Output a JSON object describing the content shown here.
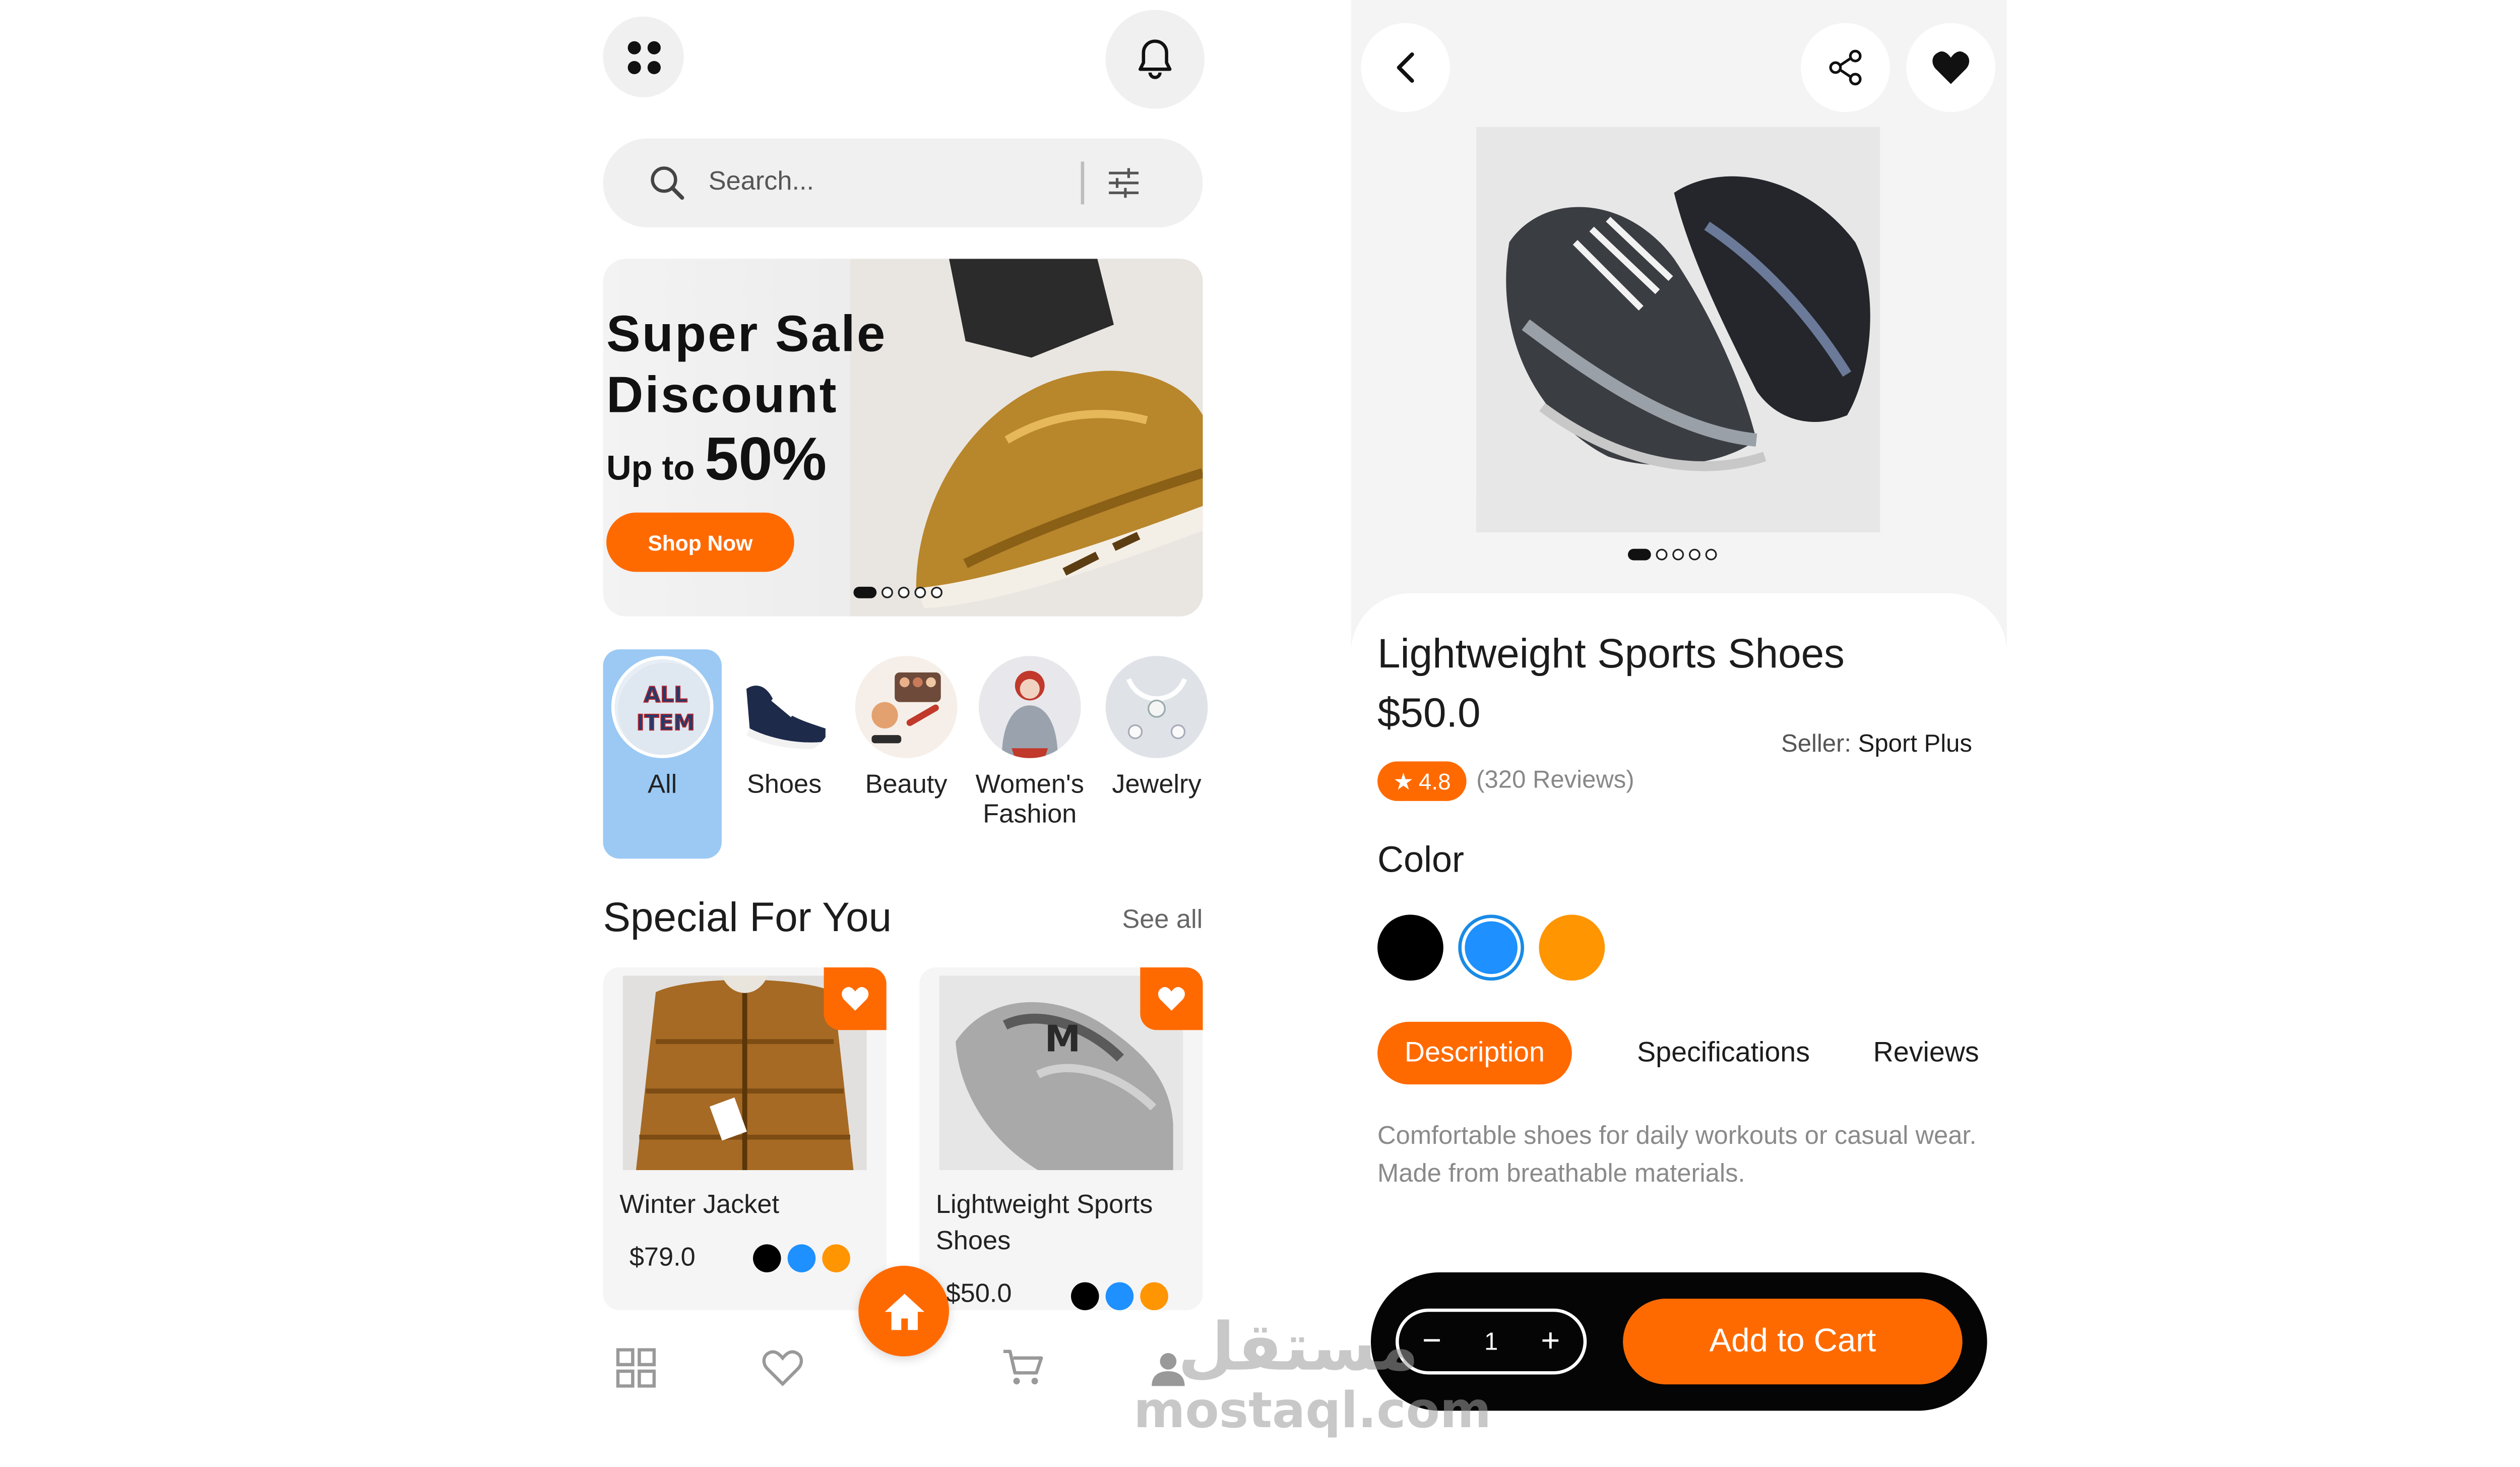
{
  "home": {
    "search": {
      "placeholder": "Search..."
    },
    "banner": {
      "line1": "Super Sale",
      "line2": "Discount",
      "upto": "Up to",
      "percent": "50%",
      "cta": "Shop Now",
      "pages": 5,
      "active_page": 1
    },
    "categories": [
      {
        "label": "All",
        "image_text": "ALL ITEM",
        "selected": true
      },
      {
        "label": "Shoes",
        "selected": false
      },
      {
        "label": "Beauty",
        "selected": false
      },
      {
        "label": "Women's Fashion",
        "selected": false
      },
      {
        "label": "Jewelry",
        "selected": false
      }
    ],
    "section": {
      "title": "Special For You",
      "see_all": "See all"
    },
    "products": [
      {
        "name": "Winter Jacket",
        "price": "$79.0",
        "colors": [
          "#000000",
          "#1e90ff",
          "#ff9500"
        ]
      },
      {
        "name": "Lightweight Sports Shoes",
        "price": "$50.0",
        "colors": [
          "#000000",
          "#1e90ff",
          "#ff9500"
        ]
      }
    ],
    "nav": [
      "grid-icon",
      "heart-icon",
      "home-icon",
      "cart-icon",
      "profile-icon"
    ]
  },
  "detail": {
    "title": "Lightweight Sports Shoes",
    "price": "$50.0",
    "seller_label": "Seller:",
    "seller_name": "Sport Plus",
    "rating": "4.8",
    "reviews": "(320 Reviews)",
    "color_label": "Color",
    "colors": [
      {
        "hex": "#000000",
        "selected": false
      },
      {
        "hex": "#1e90ff",
        "selected": true
      },
      {
        "hex": "#ff9500",
        "selected": false
      }
    ],
    "tabs": [
      {
        "label": "Description",
        "active": true
      },
      {
        "label": "Specifications",
        "active": false
      },
      {
        "label": "Reviews",
        "active": false
      }
    ],
    "description": "Comfortable shoes for daily workouts or casual wear. Made from breathable materials.",
    "quantity": "1",
    "qty_minus": "−",
    "qty_plus": "+",
    "add_to_cart": "Add to Cart",
    "gallery_pages": 5,
    "gallery_active": 1
  },
  "watermark": {
    "arabic": "مستقل",
    "latin": "mostaql.com"
  },
  "theme": {
    "accent": "#ff6a00",
    "selected_category": "#9bc9f4",
    "background_gray": "#f0f0f0"
  }
}
